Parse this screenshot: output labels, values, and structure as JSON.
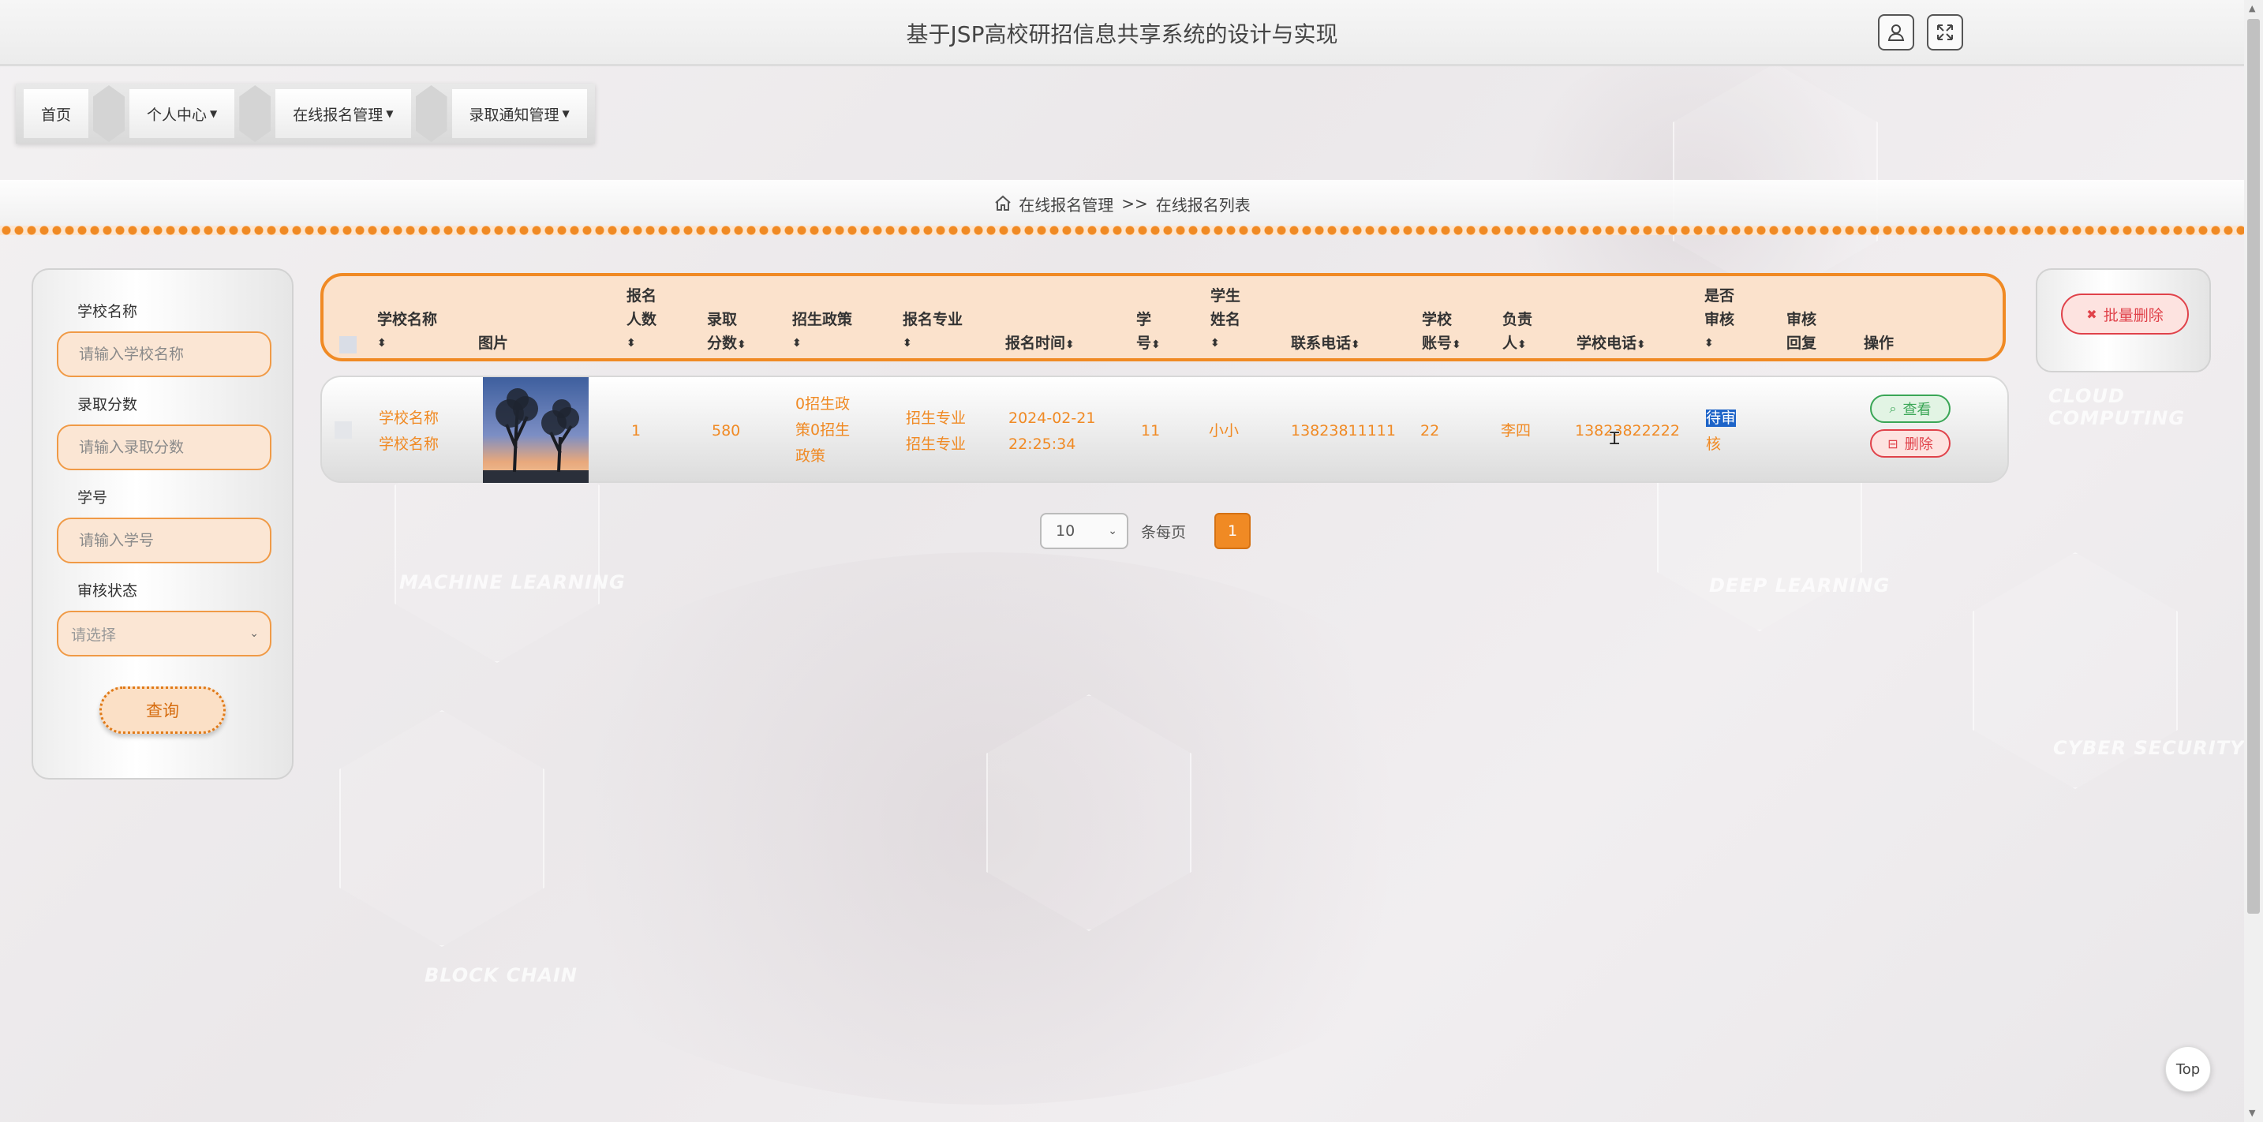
{
  "header": {
    "title": "基于JSP高校研招信息共享系统的设计与实现"
  },
  "nav": {
    "items": [
      {
        "label": "首页",
        "dropdown": false
      },
      {
        "label": "个人中心",
        "dropdown": true
      },
      {
        "label": "在线报名管理",
        "dropdown": true
      },
      {
        "label": "录取通知管理",
        "dropdown": true
      }
    ]
  },
  "breadcrumb": {
    "parent": "在线报名管理",
    "separator": ">>",
    "current": "在线报名列表"
  },
  "search": {
    "school_name_label": "学校名称",
    "school_name_placeholder": "请输入学校名称",
    "score_label": "录取分数",
    "score_placeholder": "请输入录取分数",
    "student_no_label": "学号",
    "student_no_placeholder": "请输入学号",
    "audit_label": "审核状态",
    "audit_placeholder": "请选择",
    "query_button": "查询"
  },
  "batch_delete": {
    "label": "批量删除"
  },
  "table": {
    "headers": {
      "school_name": "学校名称",
      "image": "图片",
      "count_l1": "报名",
      "count_l2": "人数",
      "score_l1": "录取",
      "score_l2": "分数",
      "policy": "招生政策",
      "major": "报名专业",
      "time": "报名时间",
      "sno_l1": "学",
      "sno_l2": "号",
      "sname_l1": "学生",
      "sname_l2": "姓名",
      "phone": "联系电话",
      "account_l1": "学校",
      "account_l2": "账号",
      "owner_l1": "负责",
      "owner_l2": "人",
      "school_phone": "学校电话",
      "audited_l1": "是否",
      "audited_l2": "审核",
      "reply_l1": "审核",
      "reply_l2": "回复",
      "actions": "操作"
    },
    "rows": [
      {
        "school_l1": "学校名称",
        "school_l2": "学校名称",
        "count": "1",
        "score": "580",
        "policy_l1": "0招生政",
        "policy_l2": "策0招生",
        "policy_l3": "政策",
        "major_l1": "招生专业",
        "major_l2": "招生专业",
        "time_l1": "2024-02-21",
        "time_l2": "22:25:34",
        "student_no": "11",
        "student_name": "小小",
        "phone": "13823811111",
        "account": "22",
        "owner": "李四",
        "school_phone": "13823822222",
        "status_l1": "待审",
        "status_l2": "核",
        "reply": "",
        "view_label": "查看",
        "delete_label": "删除"
      }
    ]
  },
  "pagination": {
    "page_size": "10",
    "per_page_text": "条每页",
    "current_page": "1"
  },
  "top_button": "Top",
  "background_words": [
    "CLOUD COMPUTING",
    "MACHINE LEARNING",
    "DEEP LEARNING",
    "CYBER SECURITY",
    "BLOCK CHAIN"
  ],
  "colors": {
    "accent": "#f08a24",
    "danger": "#e0424a",
    "success": "#3aa656",
    "highlight": "#1e64c8"
  }
}
